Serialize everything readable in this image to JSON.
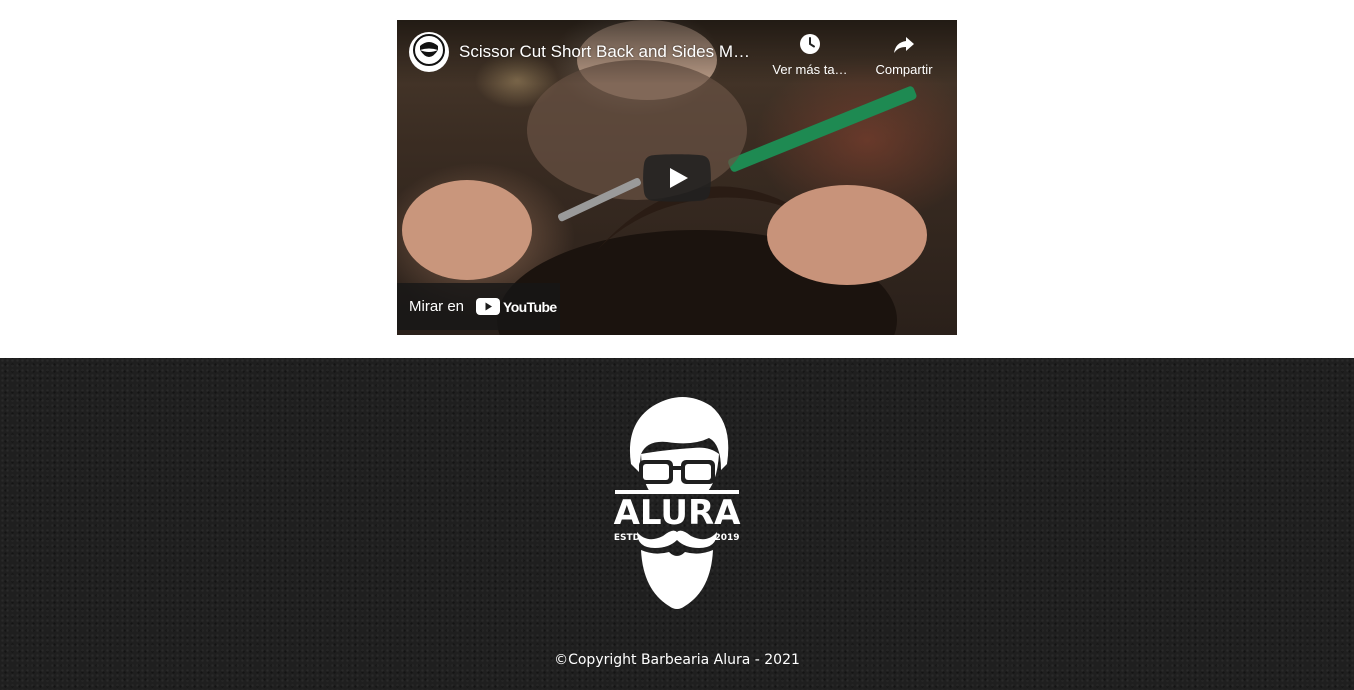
{
  "video": {
    "title": "Scissor Cut Short Back and Sides M…",
    "watch_later_label": "Ver más ta…",
    "share_label": "Compartir",
    "watch_on_label": "Mirar en",
    "youtube_wordmark": "YouTube"
  },
  "footer": {
    "logo": {
      "brand": "ALURA",
      "estd": "ESTD",
      "year": "2019"
    },
    "copyright": "©Copyright Barbearia Alura - 2021"
  },
  "colors": {
    "footer_background": "#1f1f1f",
    "youtube_red": "#ff0000",
    "text_light": "#ffffff"
  },
  "icons": [
    "beard-avatar-icon",
    "clock-icon",
    "share-arrow-icon",
    "play-icon",
    "youtube-logo-icon",
    "barber-logo"
  ]
}
